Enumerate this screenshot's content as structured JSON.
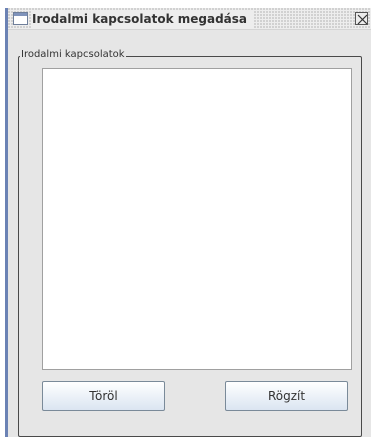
{
  "window": {
    "title": "Irodalmi kapcsolatok megadása",
    "icons": {
      "window": "window-icon",
      "close": "close-icon"
    }
  },
  "group": {
    "legend": "Irodalmi kapcsolatok"
  },
  "list": {
    "items": []
  },
  "buttons": {
    "delete_label": "Töröl",
    "save_label": "Rögzít"
  },
  "colors": {
    "window_border": "#6b82b4",
    "background": "#e6e6e6",
    "button_gradient_bottom": "#dbe5f1"
  }
}
